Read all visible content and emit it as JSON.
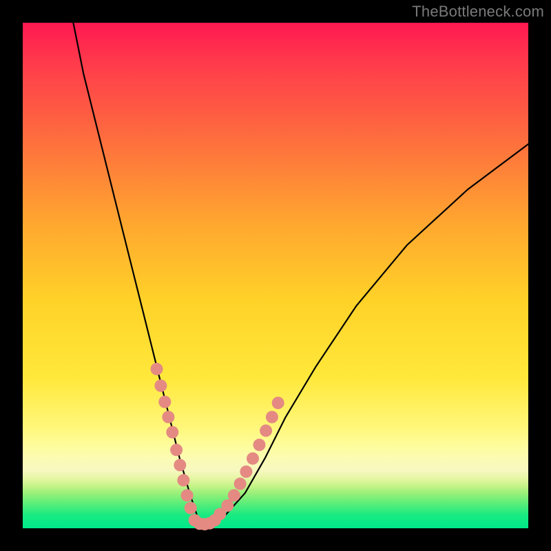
{
  "watermark": "TheBottleneck.com",
  "chart_data": {
    "type": "line",
    "title": "",
    "xlabel": "",
    "ylabel": "",
    "xlim": [
      0,
      100
    ],
    "ylim": [
      0,
      100
    ],
    "series": [
      {
        "name": "bottleneck-curve",
        "x": [
          10,
          12,
          15,
          18,
          21,
          24,
          27,
          29,
          31,
          33,
          34.5,
          36,
          40,
          44,
          48,
          52,
          58,
          66,
          76,
          88,
          100
        ],
        "y": [
          100,
          90,
          78,
          66,
          54,
          42,
          30,
          22,
          14,
          7,
          2.5,
          0.8,
          2.5,
          7,
          14,
          22,
          32,
          44,
          56,
          67,
          76
        ]
      },
      {
        "name": "left-cluster-points",
        "x": [
          26.5,
          27.3,
          28.1,
          28.8,
          29.6,
          30.4,
          31.1,
          31.8,
          32.5,
          33.2
        ],
        "y": [
          31.5,
          28.2,
          25.0,
          22.0,
          19.0,
          15.5,
          12.5,
          9.5,
          6.5,
          4.0
        ]
      },
      {
        "name": "bottom-cluster-points",
        "x": [
          34.0,
          35.0,
          36.0,
          37.0,
          38.0
        ],
        "y": [
          1.6,
          0.9,
          0.8,
          1.0,
          1.6
        ]
      },
      {
        "name": "right-cluster-points",
        "x": [
          39.0,
          40.5,
          41.8,
          43.0,
          44.2,
          45.5,
          46.8,
          48.1,
          49.3,
          50.5
        ],
        "y": [
          2.8,
          4.5,
          6.5,
          8.8,
          11.2,
          13.8,
          16.5,
          19.3,
          22.0,
          24.8
        ]
      }
    ],
    "colors": {
      "curve": "#000000",
      "dots": "#e48a83",
      "gradient_top": "#ff1851",
      "gradient_mid": "#ffe83a",
      "gradient_bottom": "#00e98a",
      "frame": "#000000"
    }
  }
}
